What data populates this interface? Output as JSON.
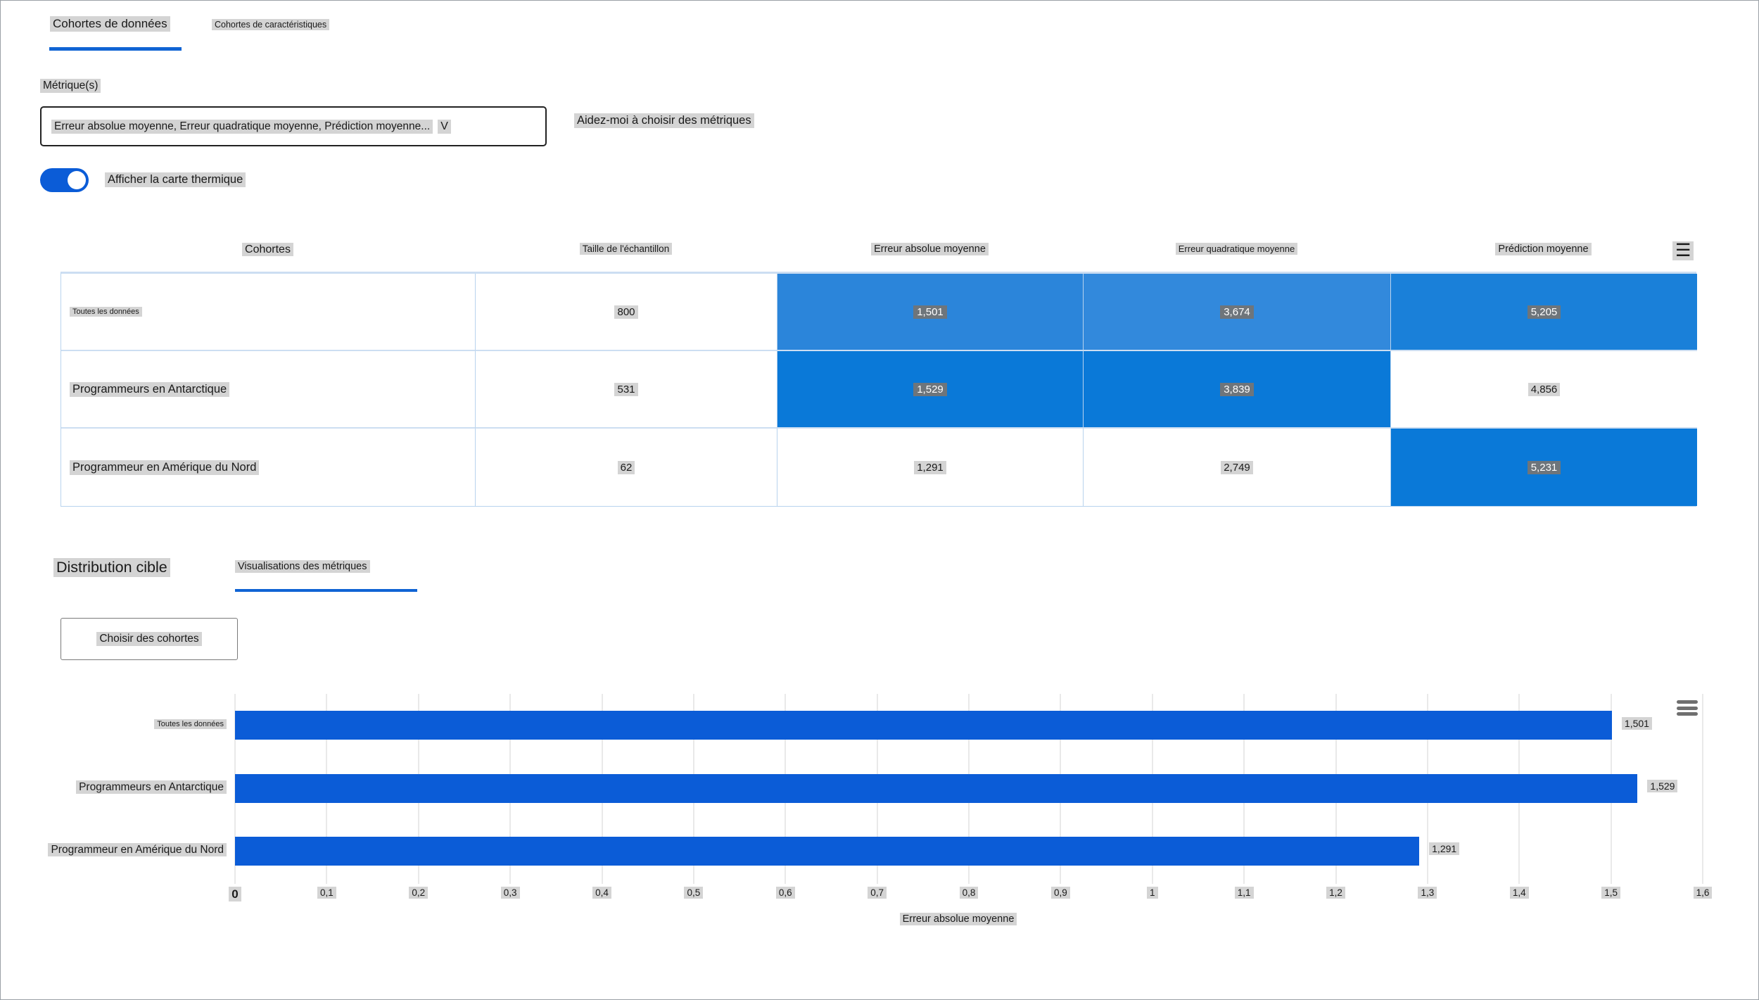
{
  "tabs": [
    {
      "label": "Cohortes de données",
      "active": true
    },
    {
      "label": "Cohortes de caractéristiques",
      "active": false
    }
  ],
  "metrics": {
    "label": "Métrique(s)",
    "selected_value": "Erreur absolue moyenne, Erreur quadratique moyenne, Prédiction moyenne...",
    "dropdown_chevron": "V",
    "help_link": "Aidez-moi à choisir des métriques"
  },
  "heatmap_toggle": {
    "label": "Afficher la carte thermique",
    "state": "on"
  },
  "table": {
    "headers": [
      "Cohortes",
      "Taille de l'échantillon",
      "Erreur absolue moyenne",
      "Erreur quadratique moyenne",
      "Prédiction moyenne"
    ],
    "menu_icon": "☰",
    "rows": [
      {
        "cohort": "Toutes les données",
        "size": "800",
        "cells": [
          {
            "value": "1,501",
            "bg": "#2b85da",
            "fg": "#ffffff"
          },
          {
            "value": "3,674",
            "bg": "#3289dc",
            "fg": "#ffffff"
          },
          {
            "value": "5,205",
            "bg": "#1a80d9",
            "fg": "#ffffff"
          }
        ]
      },
      {
        "cohort": "Programmeurs en Antarctique",
        "size": "531",
        "cells": [
          {
            "value": "1,529",
            "bg": "#0a79d8",
            "fg": "#ffffff"
          },
          {
            "value": "3,839",
            "bg": "#0a79d8",
            "fg": "#ffffff"
          },
          {
            "value": "4,856",
            "bg": "#ffffff",
            "fg": "#1a1a1a"
          }
        ]
      },
      {
        "cohort": "Programmeur en Amérique du Nord",
        "size": "62",
        "cells": [
          {
            "value": "1,291",
            "bg": "#ffffff",
            "fg": "#1a1a1a"
          },
          {
            "value": "2,749",
            "bg": "#ffffff",
            "fg": "#1a1a1a"
          },
          {
            "value": "5,231",
            "bg": "#0a79d8",
            "fg": "#ffffff"
          }
        ]
      }
    ]
  },
  "distribution": {
    "tab_target": "Distribution cible",
    "tab_visualizations": "Visualisations des métriques",
    "choose_cohorts_button": "Choisir des cohortes"
  },
  "chart_data": {
    "type": "bar",
    "orientation": "horizontal",
    "categories": [
      "Toutes les données",
      "Programmeurs en Antarctique",
      "Programmeur en Amérique du Nord"
    ],
    "values": [
      1.501,
      1.529,
      1.291
    ],
    "value_labels": [
      "1,501",
      "1,529",
      "1,291"
    ],
    "xlabel": "Erreur absolue moyenne",
    "xlim": [
      0,
      1.6
    ],
    "x_tick_step": 0.1,
    "x_tick_labels": [
      "0",
      "0,1",
      "0,2",
      "0,3",
      "0,4",
      "0,5",
      "0,6",
      "0,7",
      "0,8",
      "0,9",
      "1",
      "1,1",
      "1,2",
      "1,3",
      "1,4",
      "1,5",
      "1,6"
    ],
    "grid": true,
    "legend": "none",
    "bar_color": "#0b5cd7"
  },
  "colors": {
    "accent_underline": "#1064d4",
    "toggle_on": "#0b5cd7",
    "table_border": "#b8d3ee",
    "text_highlight": "#d4d4d4",
    "text_highlight_on_blue": "#6e757b"
  }
}
